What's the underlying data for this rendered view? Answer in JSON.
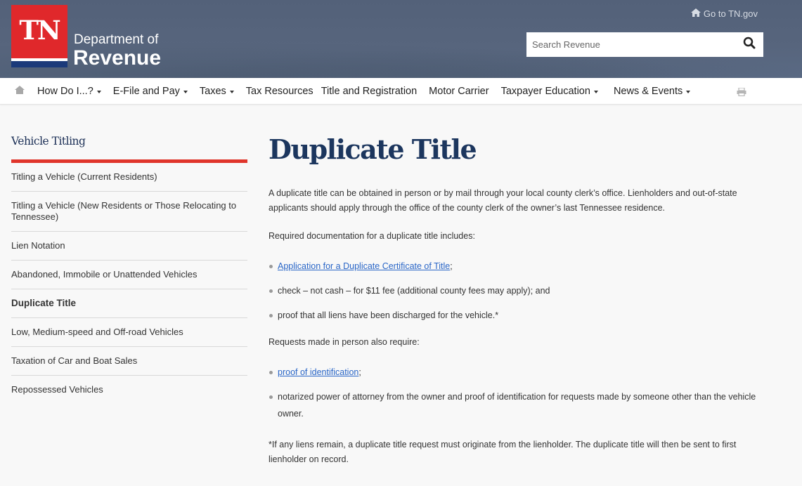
{
  "header": {
    "logo_abbr": "TN",
    "logo_line1": "Department of",
    "logo_line2": "Revenue",
    "go_tn_label": "Go to TN.gov",
    "search_placeholder": "Search Revenue"
  },
  "nav": {
    "items": [
      {
        "label": "How Do I...?",
        "dropdown": true
      },
      {
        "label": "E-File and Pay",
        "dropdown": true
      },
      {
        "label": "Taxes",
        "dropdown": true
      },
      {
        "label": "Tax Resources",
        "dropdown": false
      },
      {
        "label": "Title and Registration",
        "dropdown": false
      },
      {
        "label": "Motor Carrier",
        "dropdown": false
      },
      {
        "label": "Taxpayer Education",
        "dropdown": true
      },
      {
        "label": "News & Events",
        "dropdown": true
      }
    ]
  },
  "sidebar": {
    "title": "Vehicle Titling",
    "items": [
      {
        "label": "Titling a Vehicle (Current Residents)",
        "active": false
      },
      {
        "label": "Titling a Vehicle (New Residents or Those Relocating to Tennessee)",
        "active": false
      },
      {
        "label": "Lien Notation",
        "active": false
      },
      {
        "label": "Abandoned, Immobile or Unattended Vehicles",
        "active": false
      },
      {
        "label": "Duplicate Title",
        "active": true
      },
      {
        "label": "Low, Medium-speed and Off-road Vehicles",
        "active": false
      },
      {
        "label": "Taxation of Car and Boat Sales",
        "active": false
      },
      {
        "label": "Repossessed Vehicles",
        "active": false
      }
    ]
  },
  "main": {
    "title": "Duplicate Title",
    "intro": "A duplicate title can be obtained in person or by mail through your local county clerk’s office. Lienholders and out-of-state applicants should apply through the office of the county clerk of the owner’s last Tennessee residence.",
    "req_heading": "Required documentation for a duplicate title includes:",
    "req_items": {
      "link1": "Application for a Duplicate Certificate of Title",
      "link1_suffix": ";",
      "item2": "check – not cash – for $11 fee (additional county fees may apply); and",
      "item3": "proof that all liens have been discharged for the vehicle.*"
    },
    "person_heading": "Requests made in person also require:",
    "person_items": {
      "link1": "proof of identification",
      "link1_suffix": ";",
      "item2": "notarized power of attorney from the owner and proof of identification for requests made by someone other than the vehicle owner."
    },
    "footnote": "*If any liens remain, a duplicate title request must originate from the lienholder. The duplicate title will then be sent to first lienholder on record."
  },
  "colors": {
    "brand_red": "#e0282b",
    "brand_blue": "#1b3a7a",
    "title_navy": "#1c365e",
    "link": "#2a66c7",
    "sidebar_accent": "#e0352b"
  }
}
